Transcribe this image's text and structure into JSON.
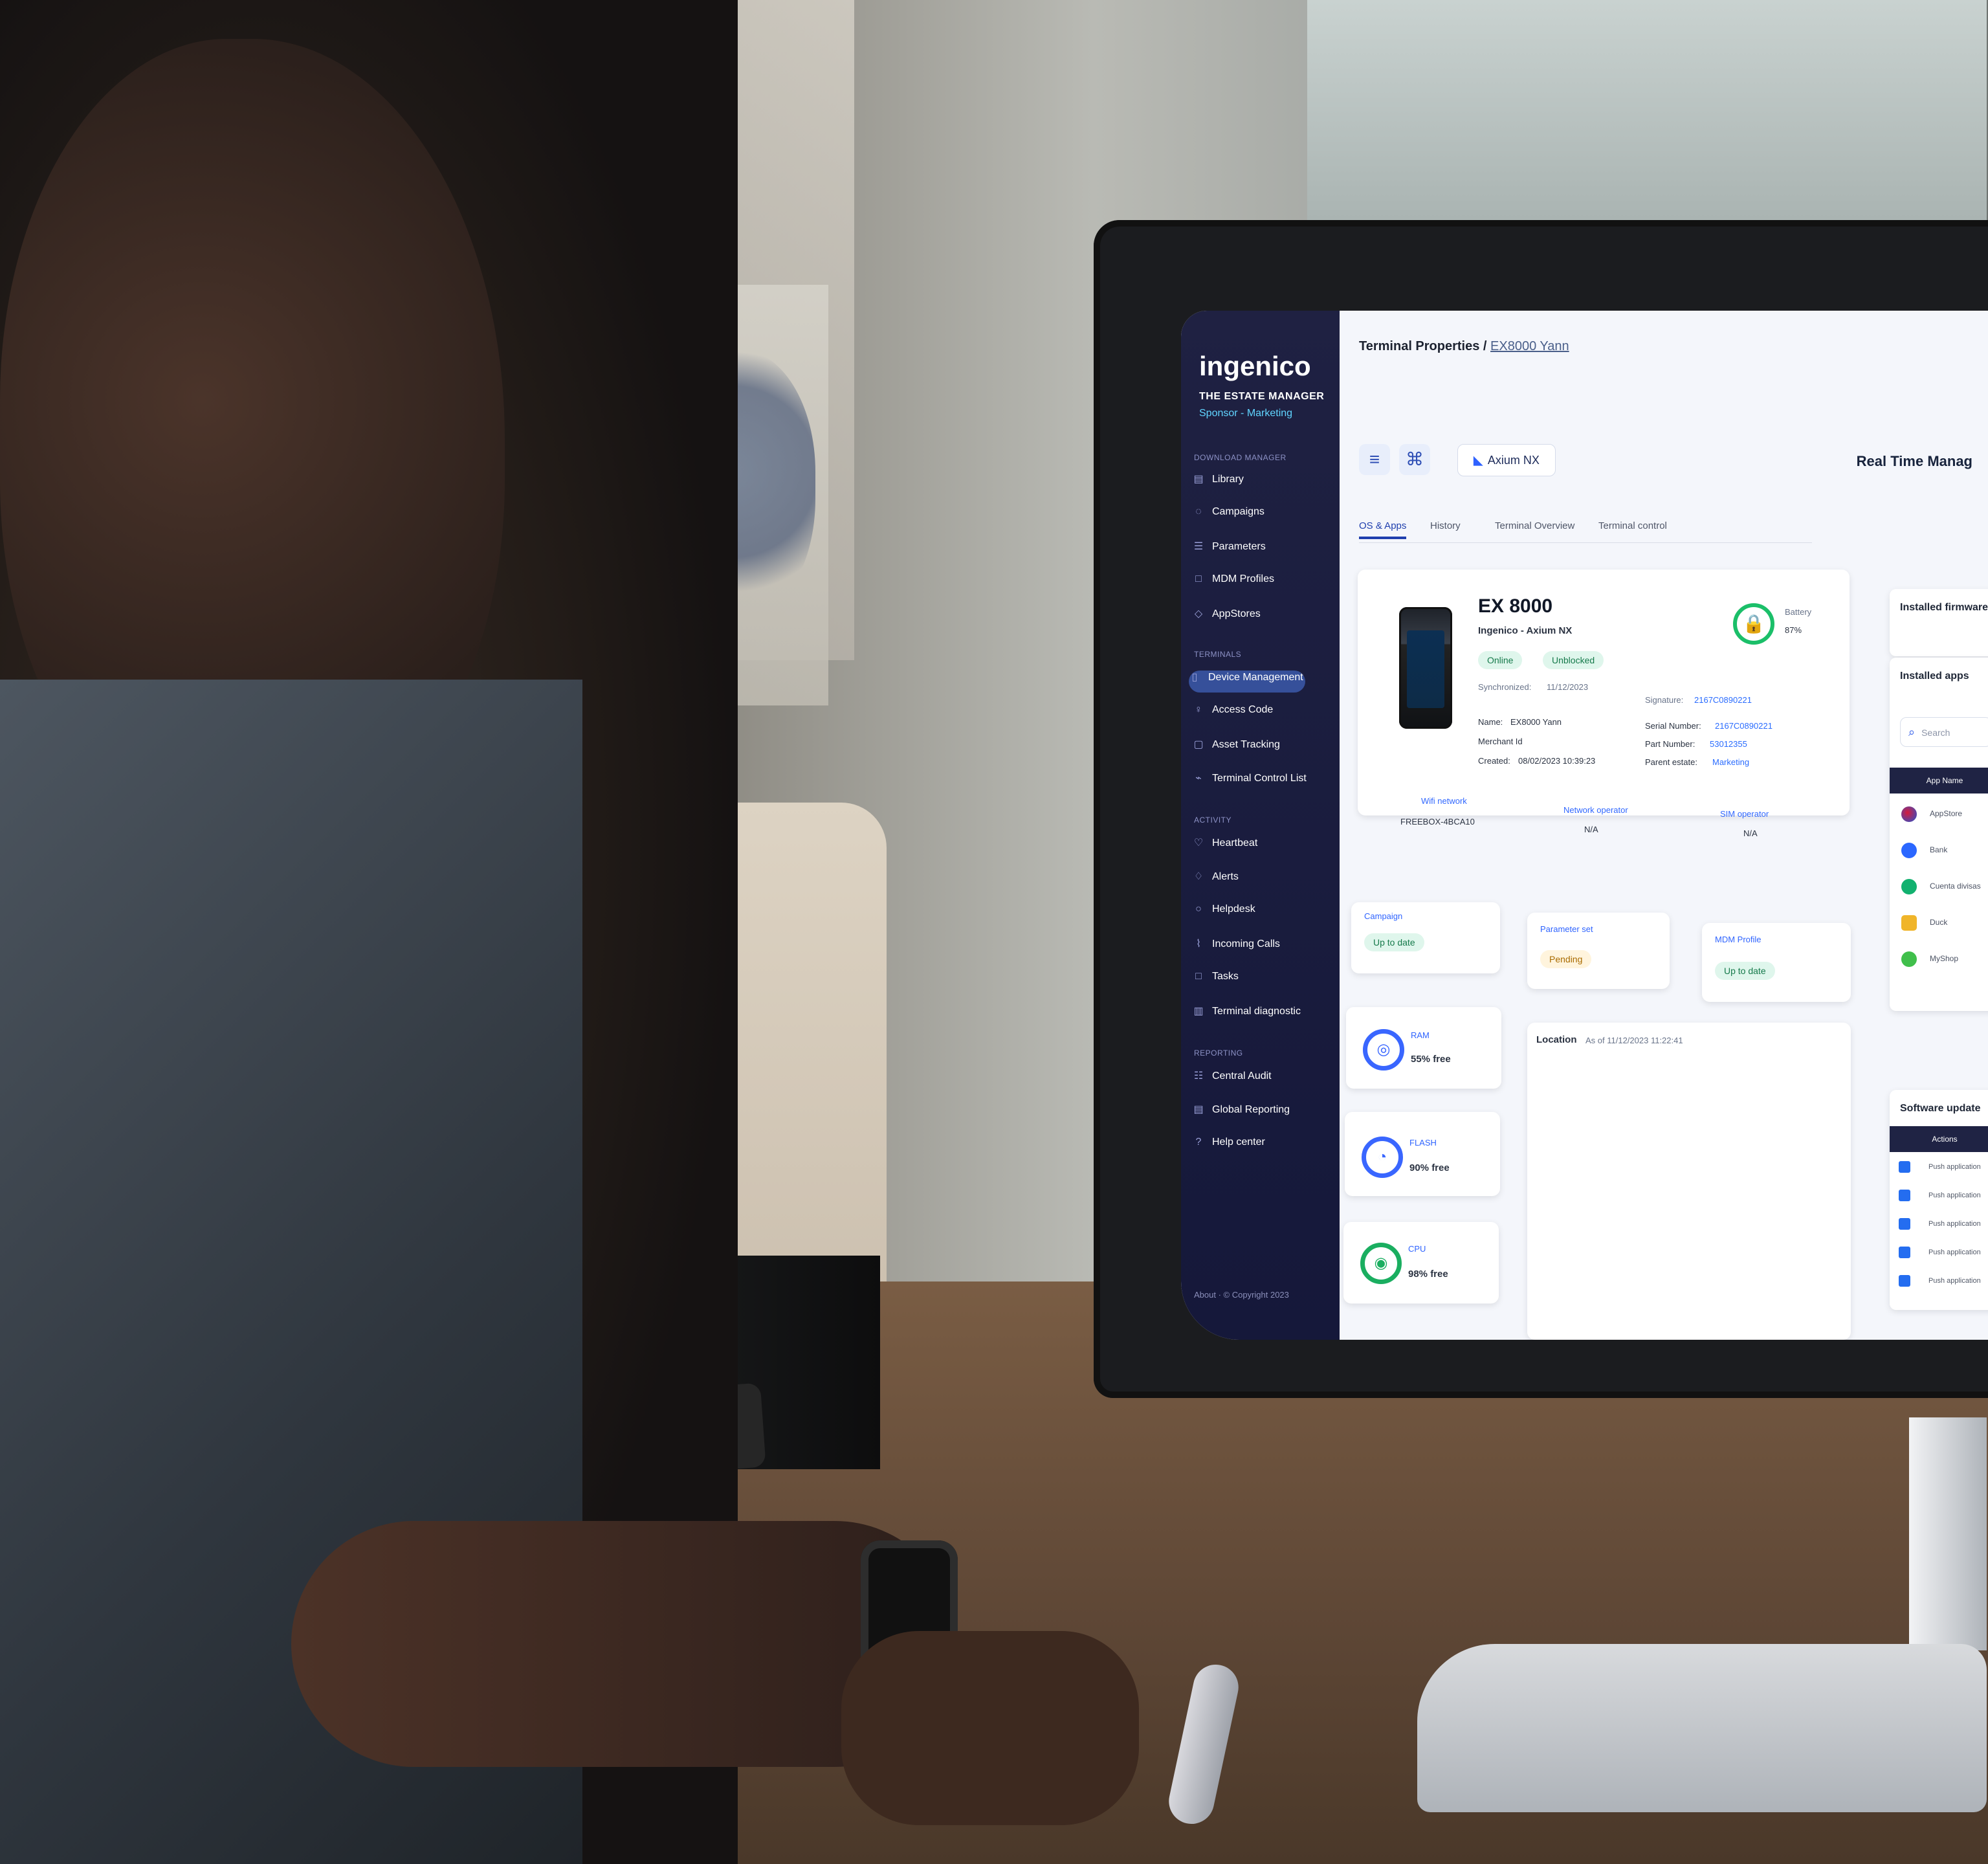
{
  "app": {
    "brand": "ingenico",
    "subtitle": "THE ESTATE MANAGER",
    "estate": "Sponsor - Marketing"
  },
  "sidebar": {
    "download_manager": "DOWNLOAD MANAGER",
    "terminals": "TERMINALS",
    "activity": "ACTIVITY",
    "reporting": "REPORTING",
    "items": [
      {
        "label": "Library",
        "icon": "library-icon"
      },
      {
        "label": "Campaigns",
        "icon": "campaign-icon"
      },
      {
        "label": "Parameters",
        "icon": "parameters-icon"
      },
      {
        "label": "MDM Profiles",
        "icon": "profile-icon"
      },
      {
        "label": "AppStores",
        "icon": "store-icon"
      },
      {
        "label": "Device Management",
        "icon": "device-icon",
        "active": true
      },
      {
        "label": "Access Code",
        "icon": "key-icon"
      },
      {
        "label": "Asset Tracking",
        "icon": "asset-icon"
      },
      {
        "label": "Terminal Control List",
        "icon": "list-icon"
      },
      {
        "label": "Heartbeat",
        "icon": "heartbeat-icon"
      },
      {
        "label": "Alerts",
        "icon": "alert-icon"
      },
      {
        "label": "Helpdesk",
        "icon": "helpdesk-icon"
      },
      {
        "label": "Incoming Calls",
        "icon": "call-icon"
      },
      {
        "label": "Tasks",
        "icon": "tasks-icon"
      },
      {
        "label": "Terminal diagnostic",
        "icon": "diagnostic-icon"
      },
      {
        "label": "Central Audit",
        "icon": "audit-icon"
      },
      {
        "label": "Global Reporting",
        "icon": "report-icon"
      },
      {
        "label": "Help center",
        "icon": "help-icon"
      }
    ],
    "footer": "About · © Copyright 2023"
  },
  "header": {
    "breadcrumb": "Terminal Properties",
    "terminal": "EX8000 Yann",
    "model": "Axium NX",
    "page": "Real Time Manag"
  },
  "tabs": [
    "OS & Apps",
    "History",
    "Terminal Overview",
    "Terminal control"
  ],
  "device": {
    "name": "EX 8000",
    "manufacturer": "Ingenico - Axium NX",
    "online": "Online",
    "unblocked": "Unblocked",
    "battery_label": "Battery",
    "battery_value": "87%",
    "synchronized_label": "Synchronized:",
    "synchronized": "11/12/2023",
    "signature_label": "Signature:",
    "signature": "2167C0890221",
    "name_label": "Name:",
    "terminal_name": "EX8000 Yann",
    "merchant_label": "Merchant Id",
    "created_label": "Created:",
    "created": "08/02/2023 10:39:23",
    "serial_label": "Serial Number:",
    "serial": "2167C0890221",
    "part_label": "Part Number:",
    "part": "53012355",
    "parent_label": "Parent estate:",
    "parent": "Marketing",
    "wifi_label": "Wifi network",
    "wifi": "FREEBOX-4BCA10",
    "network_label": "Network operator",
    "network": "N/A",
    "sim_label": "SIM operator",
    "sim": "N/A"
  },
  "status": {
    "campaign_label": "Campaign",
    "campaign": "Up to date",
    "parameter_label": "Parameter set",
    "parameter": "Pending",
    "mdm_label": "MDM Profile",
    "mdm": "Up to date"
  },
  "metrics": [
    {
      "label": "RAM",
      "value": "55% free"
    },
    {
      "label": "FLASH",
      "value": "90% free"
    },
    {
      "label": "CPU",
      "value": "98% free"
    }
  ],
  "location": {
    "label": "Location",
    "as_of": "As of 11/12/2023 11:22:41"
  },
  "right_panel": {
    "firmware": "Installed firmware",
    "apps": "Installed apps",
    "search": "Search",
    "app_header": "App Name",
    "apps_list": [
      "AppStore",
      "Bank",
      "Cuenta divisas",
      "Duck",
      "MyShop"
    ],
    "software": "Software update",
    "software_header": "Actions",
    "update_actions": [
      "Push application",
      "Push application",
      "Push application",
      "Push application",
      "Push application"
    ]
  }
}
